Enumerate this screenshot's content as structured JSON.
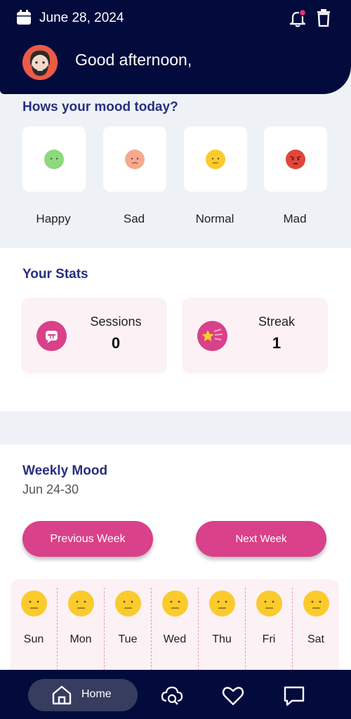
{
  "header": {
    "date": "June 28, 2024",
    "greeting": "Good afternoon,"
  },
  "mood": {
    "title": "Hows your mood today?",
    "options": [
      {
        "label": "Happy",
        "color": "#8ed87e"
      },
      {
        "label": "Sad",
        "color": "#f5a98f"
      },
      {
        "label": "Normal",
        "color": "#fbcb2c"
      },
      {
        "label": "Mad",
        "color": "#e0463c"
      }
    ]
  },
  "stats": {
    "title": "Your Stats",
    "cards": [
      {
        "label": "Sessions",
        "value": "0",
        "icon": "chat-bubble-icon"
      },
      {
        "label": "Streak",
        "value": "1",
        "icon": "shooting-star-icon"
      }
    ]
  },
  "weekly": {
    "title": "Weekly Mood",
    "range": "Jun 24-30",
    "prev_label": "Previous Week",
    "next_label": "Next Week",
    "days": [
      "Sun",
      "Mon",
      "Tue",
      "Wed",
      "Thu",
      "Fri",
      "Sat"
    ]
  },
  "nav": {
    "home_label": "Home"
  },
  "colors": {
    "navy": "#030b3d",
    "accent": "#d9418a",
    "title": "#27307f"
  }
}
